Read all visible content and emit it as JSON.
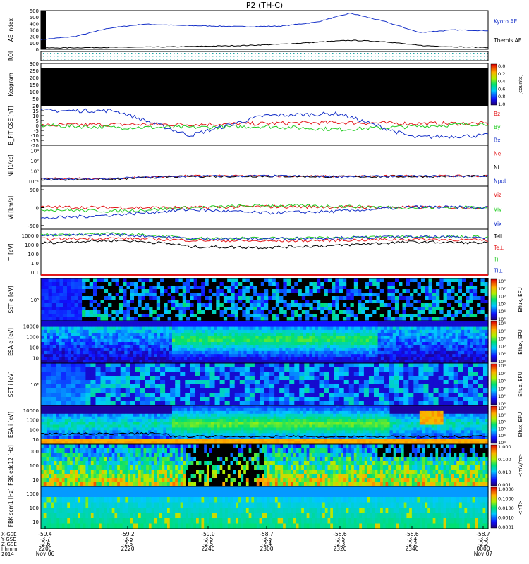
{
  "title": "P2 (TH-C)",
  "colors": {
    "red": "#e31a1c",
    "green": "#22cc22",
    "blue": "#1530c8",
    "black": "#000000",
    "navy": "#0c1f8c"
  },
  "time_axis": {
    "ticks": [
      "2200",
      "2220",
      "2240",
      "2300",
      "2320",
      "2340",
      "0000"
    ],
    "xgse": [
      "-59.4",
      "-59.2",
      "-59.0",
      "-58.7",
      "-58.6",
      "-58.6",
      "-58.7"
    ],
    "ygse": [
      "-3.7",
      "-3.6",
      "-3.5",
      "-3.5",
      "-3.5",
      "-3.4",
      "-3.3"
    ],
    "zgse": [
      "-2.6",
      "-2.5",
      "-2.5",
      "-2.4",
      "-2.3",
      "-2.2",
      "-2.2"
    ],
    "row_labels": [
      "X-GSE",
      "Y-GSE",
      "Z-GSE",
      "hhmm",
      "2014"
    ],
    "date_start": "Nov 06",
    "date_end": "Nov 07"
  },
  "chart_data": [
    {
      "type": "line",
      "panel": "ae",
      "ylabel": "AE Index",
      "ylim": [
        0,
        600
      ],
      "yticks": [
        "0",
        "100",
        "200",
        "300",
        "400",
        "500",
        "600"
      ],
      "x": [
        "2200",
        "2210",
        "2220",
        "2230",
        "2240",
        "2250",
        "2300",
        "2310",
        "2315",
        "2320",
        "2330",
        "2340",
        "2350",
        "0000"
      ],
      "series": [
        {
          "name": "Kyoto AE",
          "color": "#1530c8",
          "values": [
            150,
            200,
            330,
            390,
            370,
            360,
            350,
            360,
            420,
            560,
            430,
            260,
            300,
            290
          ]
        },
        {
          "name": "Themis AE",
          "color": "#000000",
          "values": [
            20,
            25,
            30,
            35,
            40,
            50,
            60,
            80,
            110,
            140,
            120,
            60,
            40,
            30
          ]
        }
      ]
    },
    {
      "type": "heatmap",
      "panel": "roi",
      "ylabel": "ROI"
    },
    {
      "type": "heatmap",
      "panel": "keogram",
      "ylabel": "Keogram",
      "ylim": [
        0,
        300
      ],
      "yticks": [
        "0",
        "50",
        "100",
        "150",
        "200",
        "250",
        "300"
      ],
      "colorbar": {
        "label": "[counts]",
        "ticks": [
          "0.0",
          "0.2",
          "0.4",
          "0.6",
          "0.8",
          "1.0"
        ]
      }
    },
    {
      "type": "line",
      "panel": "bfield",
      "ylabel": "B_FIT GSE [nT]",
      "ylim": [
        -20,
        20
      ],
      "yticks": [
        "20",
        "15",
        "10",
        "5",
        "0",
        "-5",
        "-10",
        "-15",
        "-20"
      ],
      "x": [
        "2200",
        "2220",
        "2240",
        "2300",
        "2320",
        "2340",
        "0000"
      ],
      "series": [
        {
          "name": "Bz",
          "color": "#e31a1c",
          "values": [
            0,
            1,
            1,
            2,
            3,
            2,
            2
          ]
        },
        {
          "name": "By",
          "color": "#22cc22",
          "values": [
            0,
            -2,
            -2,
            -1,
            -4,
            -1,
            2
          ]
        },
        {
          "name": "Bx",
          "color": "#1530c8",
          "values": [
            15,
            15,
            -10,
            10,
            12,
            -12,
            -10
          ]
        }
      ]
    },
    {
      "type": "line",
      "panel": "density",
      "ylabel": "Ni [1/cc]",
      "yticks": [
        "10⁴",
        "10²",
        "10⁰",
        "10⁻²"
      ],
      "series": [
        {
          "name": "Ne",
          "color": "#e31a1c"
        },
        {
          "name": "Ni",
          "color": "#000000"
        },
        {
          "name": "Npot",
          "color": "#1530c8"
        }
      ]
    },
    {
      "type": "line",
      "panel": "velocity",
      "ylabel": "Vi [km/s]",
      "ylim": [
        -600,
        600
      ],
      "yticks": [
        "500",
        "0",
        "-500"
      ],
      "x": [
        "2200",
        "2220",
        "2240",
        "2300",
        "2320",
        "2340",
        "0000"
      ],
      "series": [
        {
          "name": "Viz",
          "color": "#e31a1c",
          "values": [
            20,
            0,
            0,
            30,
            20,
            10,
            0
          ]
        },
        {
          "name": "Viy",
          "color": "#22cc22",
          "values": [
            -50,
            -100,
            0,
            60,
            40,
            0,
            20
          ]
        },
        {
          "name": "Vix",
          "color": "#1530c8",
          "values": [
            -300,
            -200,
            -50,
            -150,
            -100,
            20,
            0
          ]
        }
      ]
    },
    {
      "type": "line",
      "panel": "temperature",
      "ylabel": "Ti [eV]",
      "yscale": "log",
      "yticks": [
        "1000.0",
        "100.0",
        "10.0",
        "1.0",
        "0.1"
      ],
      "x": [
        "2200",
        "2220",
        "2240",
        "2300",
        "2320",
        "2340",
        "0000"
      ],
      "series": [
        {
          "name": "Tell",
          "color": "#000000",
          "values": [
            150,
            300,
            60,
            50,
            80,
            200,
            150
          ]
        },
        {
          "name": "Te⊥",
          "color": "#e31a1c",
          "values": [
            400,
            500,
            300,
            250,
            300,
            400,
            300
          ]
        },
        {
          "name": "Til",
          "color": "#22cc22",
          "values": [
            1200,
            1500,
            500,
            500,
            600,
            800,
            700
          ]
        },
        {
          "name": "Ti⊥",
          "color": "#1530c8",
          "values": [
            1000,
            1200,
            450,
            450,
            550,
            700,
            600
          ]
        }
      ]
    },
    {
      "type": "heatmap",
      "panel": "sst_e",
      "ylabel": "SST e [eV]",
      "yticks": [
        "10⁵"
      ],
      "colorbar": {
        "label": "Eflux, EFU",
        "ticks": [
          "10⁸",
          "10⁷",
          "10⁶",
          "10⁵",
          "10⁴",
          "10³"
        ]
      }
    },
    {
      "type": "heatmap",
      "panel": "esa_e",
      "ylabel": "ESA e [eV]",
      "yticks": [
        "10000",
        "1000",
        "100",
        "10"
      ],
      "colorbar": {
        "label": "Eflux, EFU",
        "ticks": [
          "10⁸",
          "10⁷",
          "10⁶",
          "10⁵",
          "10⁴",
          "10³"
        ]
      }
    },
    {
      "type": "heatmap",
      "panel": "sst_i",
      "ylabel": "SST i [eV]",
      "yticks": [
        "10⁵"
      ],
      "colorbar": {
        "label": "Eflux, EFU",
        "ticks": [
          "10⁸",
          "10⁷",
          "10⁶",
          "10⁵",
          "10⁴",
          "10³"
        ]
      }
    },
    {
      "type": "heatmap",
      "panel": "esa_i",
      "ylabel": "ESA i [eV]",
      "yticks": [
        "10000",
        "1000",
        "100",
        "10"
      ],
      "colorbar": {
        "label": "Eflux, EFU",
        "ticks": [
          "10⁸",
          "10⁷",
          "10⁶",
          "10⁵",
          "10⁴",
          "10³"
        ]
      }
    },
    {
      "type": "heatmap",
      "panel": "fbk_e",
      "ylabel": "FBK edc12 [Hz]",
      "yticks": [
        "1000",
        "100",
        "10"
      ],
      "colorbar": {
        "label": "<mV/m>",
        "ticks": [
          "1.000",
          "0.100",
          "0.010",
          "0.001"
        ]
      }
    },
    {
      "type": "heatmap",
      "panel": "fbk_b",
      "ylabel": "FBK scm1 [Hz]",
      "yticks": [
        "1000",
        "100",
        "10"
      ],
      "colorbar": {
        "label": "<nT>",
        "ticks": [
          "1.0000",
          "0.1000",
          "0.0100",
          "0.0010",
          "0.0001"
        ]
      }
    }
  ]
}
